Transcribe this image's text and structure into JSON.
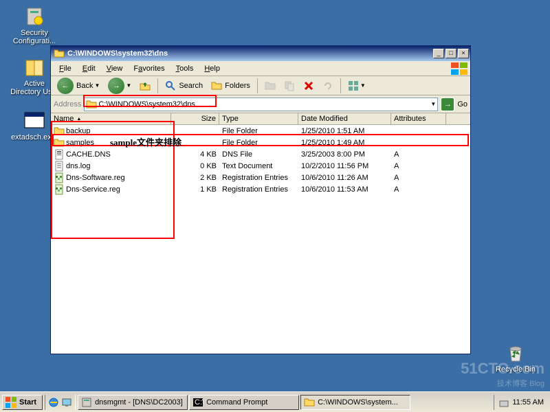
{
  "desktop": {
    "icons": [
      {
        "label": "Security Configurati..."
      },
      {
        "label": "Active Directory Us..."
      },
      {
        "label": "extadsch.ex..."
      },
      {
        "label": "Recycle Bin"
      }
    ]
  },
  "window": {
    "title": "C:\\WINDOWS\\system32\\dns",
    "menu": [
      "File",
      "Edit",
      "View",
      "Favorites",
      "Tools",
      "Help"
    ],
    "toolbar": {
      "back": "Back",
      "search": "Search",
      "folders": "Folders"
    },
    "address": {
      "label": "Address",
      "path": "C:\\WINDOWS\\system32\\dns",
      "go": "Go"
    },
    "columns": [
      "Name",
      "Size",
      "Type",
      "Date Modified",
      "Attributes"
    ],
    "rows": [
      {
        "icon": "folder",
        "name": "backup",
        "size": "",
        "type": "File Folder",
        "date": "1/25/2010 1:51 AM",
        "attr": ""
      },
      {
        "icon": "folder",
        "name": "samples",
        "size": "",
        "type": "File Folder",
        "date": "1/25/2010 1:49 AM",
        "attr": ""
      },
      {
        "icon": "dns",
        "name": "CACHE.DNS",
        "size": "4 KB",
        "type": "DNS File",
        "date": "3/25/2003 8:00 PM",
        "attr": "A"
      },
      {
        "icon": "txt",
        "name": "dns.log",
        "size": "0 KB",
        "type": "Text Document",
        "date": "10/2/2010 11:56 PM",
        "attr": "A"
      },
      {
        "icon": "reg",
        "name": "Dns-Software.reg",
        "size": "2 KB",
        "type": "Registration Entries",
        "date": "10/6/2010 11:26 AM",
        "attr": "A"
      },
      {
        "icon": "reg",
        "name": "Dns-Service.reg",
        "size": "1 KB",
        "type": "Registration Entries",
        "date": "10/6/2010 11:53 AM",
        "attr": "A"
      }
    ]
  },
  "annotation": {
    "label": "sample文件夹排除"
  },
  "taskbar": {
    "start": "Start",
    "buttons": [
      {
        "label": "dnsmgmt - [DNS\\DC2003]",
        "icon": "mmc"
      },
      {
        "label": "Command Prompt",
        "icon": "cmd"
      },
      {
        "label": "C:\\WINDOWS\\system...",
        "icon": "folder",
        "active": true
      }
    ],
    "clock": "11:55 AM"
  },
  "watermark": {
    "line1": "51CTO.com",
    "line2": "技术博客 Blog"
  }
}
